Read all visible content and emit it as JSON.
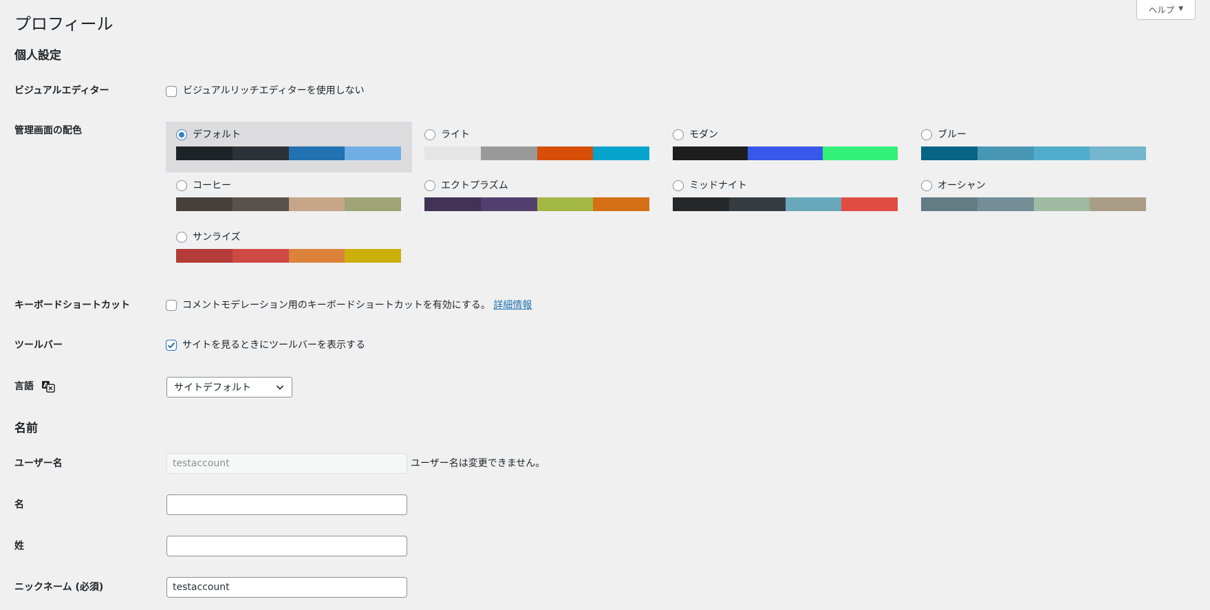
{
  "header": {
    "title": "プロフィール",
    "help_label": "ヘルプ"
  },
  "personal": {
    "section_title": "個人設定",
    "visual_editor": {
      "label": "ビジュアルエディター",
      "option": "ビジュアルリッチエディターを使用しない",
      "checked": false
    },
    "color_scheme": {
      "label": "管理画面の配色",
      "schemes": [
        {
          "name": "デフォルト",
          "selected": true,
          "colors": [
            "#1d2327",
            "#2c3338",
            "#2271b1",
            "#72aee6"
          ]
        },
        {
          "name": "ライト",
          "selected": false,
          "colors": [
            "#e5e5e5",
            "#999999",
            "#d64e07",
            "#04a4cc"
          ]
        },
        {
          "name": "モダン",
          "selected": false,
          "colors": [
            "#1e1e1e",
            "#3858e9",
            "#33f078"
          ]
        },
        {
          "name": "ブルー",
          "selected": false,
          "colors": [
            "#096484",
            "#4796b3",
            "#52accc",
            "#74b6ce"
          ]
        },
        {
          "name": "コーヒー",
          "selected": false,
          "colors": [
            "#46403c",
            "#59524c",
            "#c7a589",
            "#9ea476"
          ]
        },
        {
          "name": "エクトプラズム",
          "selected": false,
          "colors": [
            "#413256",
            "#523f6d",
            "#a3b745",
            "#d46f15"
          ]
        },
        {
          "name": "ミッドナイト",
          "selected": false,
          "colors": [
            "#25282b",
            "#363b3f",
            "#69a8bb",
            "#e14d43"
          ]
        },
        {
          "name": "オーシャン",
          "selected": false,
          "colors": [
            "#627c83",
            "#738e96",
            "#9ebaa0",
            "#aa9d88"
          ]
        },
        {
          "name": "サンライズ",
          "selected": false,
          "colors": [
            "#b43c38",
            "#cf4944",
            "#dd823b",
            "#ccaf0b"
          ]
        }
      ]
    },
    "keyboard_shortcuts": {
      "label": "キーボードショートカット",
      "option": "コメントモデレーション用のキーボードショートカットを有効にする。",
      "link": "詳細情報",
      "checked": false
    },
    "toolbar": {
      "label": "ツールバー",
      "option": "サイトを見るときにツールバーを表示する",
      "checked": true
    },
    "language": {
      "label": "言語",
      "selected": "サイトデフォルト"
    }
  },
  "name": {
    "section_title": "名前",
    "username": {
      "label": "ユーザー名",
      "value": "testaccount",
      "note": "ユーザー名は変更できません。"
    },
    "first_name": {
      "label": "名",
      "value": ""
    },
    "last_name": {
      "label": "姓",
      "value": ""
    },
    "nickname": {
      "label": "ニックネーム (必須)",
      "value": "testaccount"
    }
  }
}
